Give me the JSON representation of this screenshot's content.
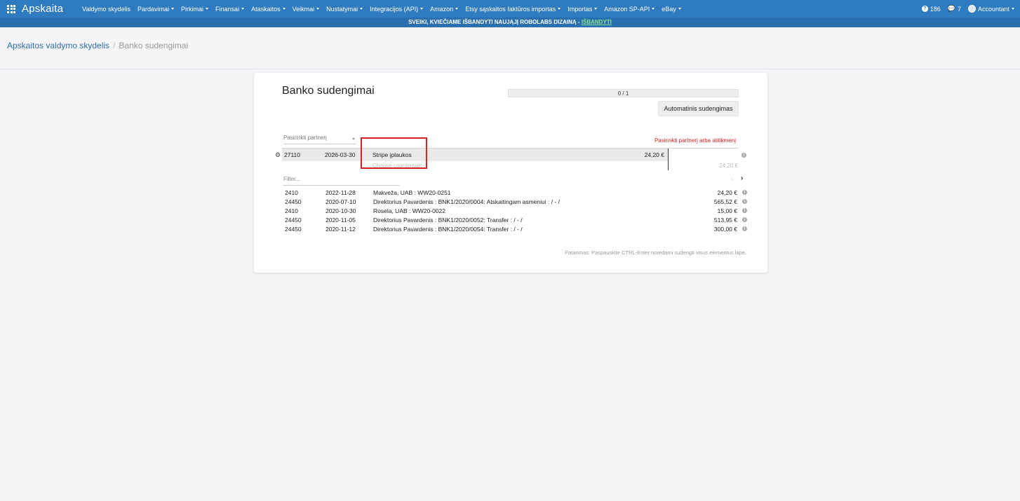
{
  "navbar": {
    "brand": "Apskaita",
    "menu": [
      {
        "label": "Valdymo skydelis",
        "caret": false
      },
      {
        "label": "Pardavimai",
        "caret": true
      },
      {
        "label": "Pirkimai",
        "caret": true
      },
      {
        "label": "Finansai",
        "caret": true
      },
      {
        "label": "Ataskaitos",
        "caret": true
      },
      {
        "label": "Veikmai",
        "caret": true
      },
      {
        "label": "Nustatymai",
        "caret": true
      },
      {
        "label": "Integracijos (API)",
        "caret": true
      },
      {
        "label": "Amazon",
        "caret": true
      },
      {
        "label": "Etsy sąskaitos faktūros importas",
        "caret": true
      },
      {
        "label": "Importas",
        "caret": true
      },
      {
        "label": "Amazon SP-API",
        "caret": true
      },
      {
        "label": "eBay",
        "caret": true
      }
    ],
    "help_count": "186",
    "messages_count": "7",
    "user": "Accountant"
  },
  "banner": {
    "text": "SVEIKI, KVIEČIAME IŠBANDYTI NAUJĄJĮ ROBOLABS DIZAINĄ - ",
    "link": "IŠBANDYTI"
  },
  "breadcrumb": {
    "parent": "Apskaitos valdymo skydelis",
    "separator": "/",
    "current": "Banko sudengimai"
  },
  "card": {
    "title": "Banko sudengimai",
    "progress": "0 / 1",
    "auto_button": "Automatinis sudengimas",
    "partner_placeholder": "Pasirinkti partnerį",
    "warning": "Pasirinkti partnerį arba atitikmenį",
    "bank_line": {
      "account": "27110",
      "date": "2026-03-30",
      "description": "Stripe įplaukos",
      "amount": "24,20 €",
      "counterpart_placeholder": "Choose counterpart",
      "sub_amount": "24,20 €"
    },
    "filter_placeholder": "Filter...",
    "pager_prev": "‹",
    "pager_next": "›",
    "candidates": [
      {
        "account": "2410",
        "date": "2022-11-28",
        "description": "Makveža, UAB : WW20-0251",
        "amount": "24,20 €"
      },
      {
        "account": "24450",
        "date": "2020-07-10",
        "description": "Direktorius Pavardenis : BNK1/2020/0004: Atskaitingam asmeniui : / - /",
        "amount": "565,52 €"
      },
      {
        "account": "2410",
        "date": "2020-10-30",
        "description": "Rosela, UAB : WW20-0022",
        "amount": "15,00 €"
      },
      {
        "account": "24450",
        "date": "2020-11-05",
        "description": "Direktorius Pavardenis : BNK1/2020/0052: Transfer : / - /",
        "amount": "513,95 €"
      },
      {
        "account": "24450",
        "date": "2020-11-12",
        "description": "Direktorius Pavardenis : BNK1/2020/0054: Transfer : / - /",
        "amount": "300,00 €"
      }
    ],
    "tip": "Patarimas: Paspauskite CTRL-Enter norėdami sudengti visus elementus lape.",
    "info_icon": "i",
    "gear_icon": "⚙"
  },
  "colors": {
    "navbar": "#2f7bbf",
    "banner": "#2a6fb0",
    "banner_link": "#8be08b",
    "warning": "#e02020",
    "highlight": "#d92020"
  }
}
